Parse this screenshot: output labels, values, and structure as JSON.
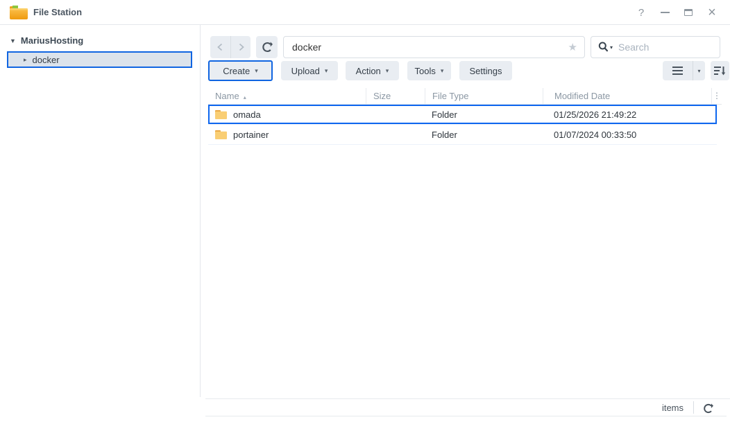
{
  "titlebar": {
    "app_title": "File Station"
  },
  "window_controls": {
    "help": "?",
    "close": "×"
  },
  "sidebar": {
    "root_label": "MariusHosting",
    "items": [
      {
        "label": "docker"
      }
    ]
  },
  "pathbar": {
    "path_value": "docker",
    "search_placeholder": "Search"
  },
  "toolbar": {
    "buttons": [
      {
        "label": "Create"
      },
      {
        "label": "Upload"
      },
      {
        "label": "Action"
      },
      {
        "label": "Tools"
      },
      {
        "label": "Settings"
      }
    ]
  },
  "table": {
    "columns": {
      "name": "Name",
      "size": "Size",
      "file_type": "File Type",
      "modified": "Modified Date"
    },
    "rows": [
      {
        "name": "omada",
        "size": "",
        "file_type": "Folder",
        "modified": "01/25/2026 21:49:22"
      },
      {
        "name": "portainer",
        "size": "",
        "file_type": "Folder",
        "modified": "01/07/2024 00:33:50"
      }
    ]
  },
  "statusbar": {
    "items_label": "items"
  },
  "icons": {
    "dropdown_caret": "▾",
    "tree_expanded_caret": "▼",
    "tree_collapsed_caret": "▸",
    "sort_ascending_caret": "▴",
    "favorite_star": "★",
    "column_options_ellipsis": "⋮"
  },
  "colors": {
    "accent": "#1065e1",
    "row_highlight_border": "#0d66ef"
  }
}
